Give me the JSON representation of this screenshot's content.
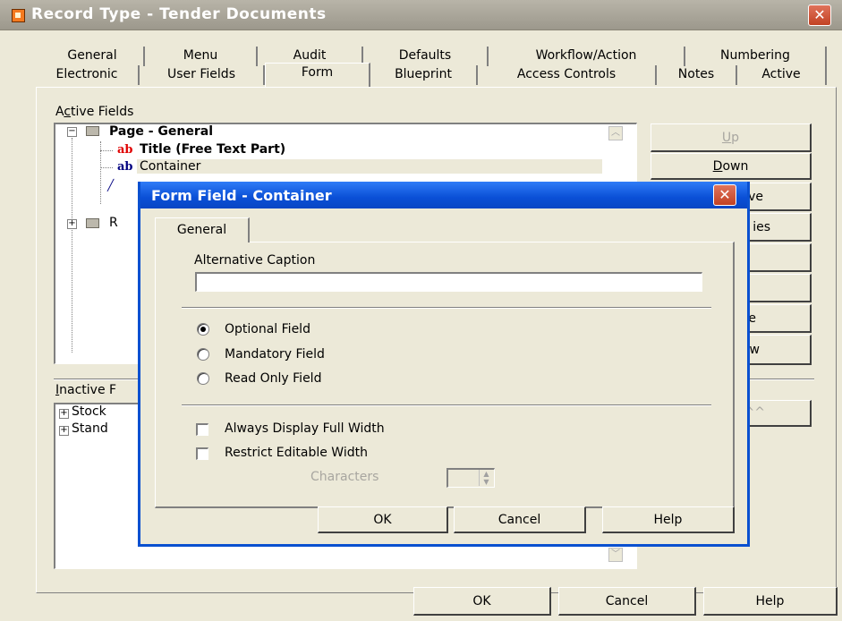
{
  "window": {
    "title": "Record Type - Tender Documents",
    "close_glyph": "✕"
  },
  "tabs_row1": [
    "General",
    "Menu",
    "Audit",
    "Defaults",
    "Workflow/Action",
    "Numbering"
  ],
  "tabs_row2": [
    "Electronic",
    "User Fields",
    "Form",
    "Blueprint",
    "Access Controls",
    "Notes",
    "Active"
  ],
  "active_tab": "Form",
  "active_fields": {
    "label_pre": "A",
    "label_u": "c",
    "label_post": "tive Fields",
    "tree": [
      {
        "text": "Page - General",
        "icon": "folder-icon",
        "expander": "−"
      },
      {
        "text": "Title (Free Text Part)",
        "icon": "ab-icon",
        "badge": "ab"
      },
      {
        "text": "Container",
        "icon": "ab-icon",
        "badge": "ab"
      },
      {
        "text": "R",
        "icon": "folder-icon",
        "expander": "+"
      }
    ]
  },
  "side_buttons": {
    "up_u": "U",
    "up_rest": "p",
    "down_u": "D",
    "down_rest": "own",
    "remove_partial": "ve",
    "properties_partial": "ies",
    "new_partial": "e",
    "preview_partial": "w",
    "add_partial": "^^"
  },
  "inactive_fields": {
    "label_u": "I",
    "label_rest": "nactive F",
    "items": [
      {
        "text": "Stock",
        "expander": "+"
      },
      {
        "text": "Stand",
        "expander": "+"
      }
    ]
  },
  "footer": {
    "ok": "OK",
    "cancel": "Cancel",
    "help": "Help"
  },
  "dialog": {
    "title": "Form Field - Container",
    "close_glyph": "✕",
    "tab": "General",
    "alt_caption_label": "Alternative Caption",
    "alt_caption_value": "",
    "radios": [
      {
        "label": "Optional Field",
        "checked": true
      },
      {
        "label": "Mandatory Field",
        "checked": false
      },
      {
        "label": "Read Only Field",
        "checked": false
      }
    ],
    "checkboxes": [
      {
        "label": "Always Display Full Width",
        "checked": false
      },
      {
        "label": "Restrict Editable Width",
        "checked": false
      }
    ],
    "characters_label": "Characters",
    "characters_value": "",
    "ok": "OK",
    "cancel": "Cancel",
    "help": "Help"
  },
  "colors": {
    "dialog_title": "#0a4fd6",
    "red_ab": "#e00000",
    "window_bg": "#ece9d8"
  }
}
